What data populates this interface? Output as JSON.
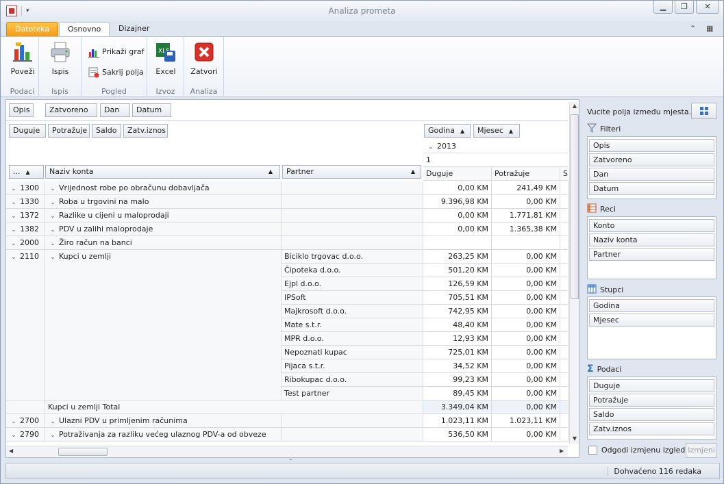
{
  "window": {
    "title": "Analiza prometa"
  },
  "tabs": [
    "Datoteka",
    "Osnovno",
    "Dizajner"
  ],
  "ribbon": {
    "groups": [
      {
        "name": "Podaci",
        "buttons": [
          {
            "label": "Poveži",
            "icon": "connect-icon"
          }
        ]
      },
      {
        "name": "Ispis",
        "buttons": [
          {
            "label": "Ispis",
            "icon": "printer-icon"
          }
        ]
      },
      {
        "name": "Pogled",
        "buttons": [
          {
            "label": "Prikaži graf",
            "icon": "chart-icon"
          },
          {
            "label": "Sakrij polja",
            "icon": "hide-fields-icon"
          }
        ]
      },
      {
        "name": "Izvoz",
        "buttons": [
          {
            "label": "Excel",
            "icon": "excel-icon"
          }
        ]
      },
      {
        "name": "Analiza",
        "buttons": [
          {
            "label": "Zatvori",
            "icon": "close-red-icon"
          }
        ]
      }
    ]
  },
  "pivot": {
    "filter_fields": [
      "Opis",
      "Zatvoreno",
      "Dan",
      "Datum"
    ],
    "data_fields": [
      "Duguje",
      "Potražuje",
      "Saldo",
      "Zatv.iznos"
    ],
    "column_fields": [
      "Godina",
      "Mjesec"
    ],
    "row_headers": [
      "...",
      "Naziv konta",
      "Partner"
    ],
    "year": "2013",
    "month": "1",
    "value_headers": [
      "Duguje",
      "Potražuje",
      "S"
    ],
    "rows": [
      {
        "konto": "1300",
        "naziv": "Vrijednost robe po obračunu dobavljača",
        "partner": "",
        "duguje": "0,00 KM",
        "potrazuje": "241,49 KM"
      },
      {
        "konto": "1330",
        "naziv": "Roba u trgovini na malo",
        "partner": "",
        "duguje": "9.396,98 KM",
        "potrazuje": "0,00 KM"
      },
      {
        "konto": "1372",
        "naziv": "Razlike u cijeni u maloprodaji",
        "partner": "",
        "duguje": "0,00 KM",
        "potrazuje": "1.771,81 KM"
      },
      {
        "konto": "1382",
        "naziv": "PDV u zalihi maloprodaje",
        "partner": "",
        "duguje": "0,00 KM",
        "potrazuje": "1.365,38 KM"
      },
      {
        "konto": "2000",
        "naziv": "Žiro račun na banci",
        "partner": "",
        "duguje": "",
        "potrazuje": ""
      },
      {
        "konto": "2110",
        "naziv": "Kupci u zemlji",
        "partner": "Biciklo trgovac d.o.o.",
        "duguje": "263,25 KM",
        "potrazuje": "0,00 KM"
      },
      {
        "konto": "",
        "naziv": "",
        "partner": "Čipoteka d.o.o.",
        "duguje": "501,20 KM",
        "potrazuje": "0,00 KM"
      },
      {
        "konto": "",
        "naziv": "",
        "partner": "Ejpl d.o.o.",
        "duguje": "126,59 KM",
        "potrazuje": "0,00 KM"
      },
      {
        "konto": "",
        "naziv": "",
        "partner": "IPSoft",
        "duguje": "705,51 KM",
        "potrazuje": "0,00 KM"
      },
      {
        "konto": "",
        "naziv": "",
        "partner": "Majkrosoft d.o.o.",
        "duguje": "742,95 KM",
        "potrazuje": "0,00 KM"
      },
      {
        "konto": "",
        "naziv": "",
        "partner": "Mate s.t.r.",
        "duguje": "48,40 KM",
        "potrazuje": "0,00 KM"
      },
      {
        "konto": "",
        "naziv": "",
        "partner": "MPR d.o.o.",
        "duguje": "12,93 KM",
        "potrazuje": "0,00 KM"
      },
      {
        "konto": "",
        "naziv": "",
        "partner": "Nepoznati kupac",
        "duguje": "725,01 KM",
        "potrazuje": "0,00 KM"
      },
      {
        "konto": "",
        "naziv": "",
        "partner": "Pijaca s.t.r.",
        "duguje": "34,52 KM",
        "potrazuje": "0,00 KM"
      },
      {
        "konto": "",
        "naziv": "",
        "partner": "Ribokupac d.o.o.",
        "duguje": "99,23 KM",
        "potrazuje": "0,00 KM"
      },
      {
        "konto": "",
        "naziv": "",
        "partner": "Test partner",
        "duguje": "89,45 KM",
        "potrazuje": "0,00 KM"
      }
    ],
    "total_row": {
      "label": "Kupci u zemlji Total",
      "duguje": "3.349,04 KM",
      "potrazuje": "0,00 KM"
    },
    "rows_after": [
      {
        "konto": "2700",
        "naziv": "Ulazni PDV u primljenim računima",
        "partner": "",
        "duguje": "1.023,11 KM",
        "potrazuje": "1.023,11 KM"
      },
      {
        "konto": "2790",
        "naziv": "Potraživanja za razliku većeg ulaznog PDV-a od obveze",
        "partner": "",
        "duguje": "536,50 KM",
        "potrazuje": "0,00 KM"
      }
    ]
  },
  "field_list": {
    "hint": "Vucite polja između mjesta...",
    "sections": [
      {
        "title": "Filteri",
        "icon": "filter-icon",
        "items": [
          "Opis",
          "Zatvoreno",
          "Dan",
          "Datum"
        ]
      },
      {
        "title": "Reci",
        "icon": "rows-icon",
        "items": [
          "Konto",
          "Naziv konta",
          "Partner"
        ]
      },
      {
        "title": "Stupci",
        "icon": "columns-icon",
        "items": [
          "Godina",
          "Mjesec"
        ]
      },
      {
        "title": "Podaci",
        "icon": "sigma-icon",
        "items": [
          "Duguje",
          "Potražuje",
          "Saldo",
          "Zatv.iznos"
        ]
      }
    ],
    "defer_label": "Odgodi izmjenu izgleda",
    "update_label": "Izmjeni"
  },
  "status": {
    "text": "Dohvaćeno 116 redaka"
  }
}
